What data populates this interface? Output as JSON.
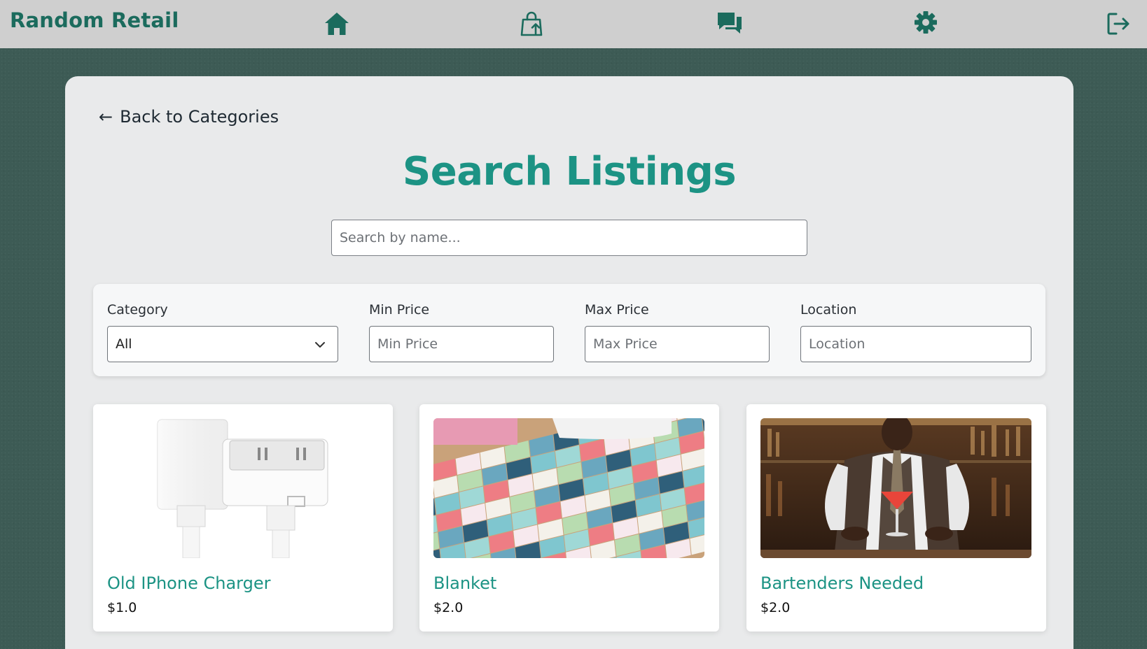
{
  "nav": {
    "brand": "Random Retail",
    "icons": [
      "home-icon",
      "shopping-bag-upload-icon",
      "chat-icon",
      "gear-icon",
      "logout-icon"
    ]
  },
  "colors": {
    "brand": "#1b6b5d",
    "accent": "#1c9384",
    "nav_bg": "#cfcfcf",
    "page_bg": "#3d5b55"
  },
  "main": {
    "back_label": "Back to Categories",
    "back_arrow": "←",
    "title": "Search Listings",
    "search_placeholder": "Search by name..."
  },
  "filters": {
    "category": {
      "label": "Category",
      "value": "All"
    },
    "min_price": {
      "label": "Min Price",
      "placeholder": "Min Price"
    },
    "max_price": {
      "label": "Max Price",
      "placeholder": "Max Price"
    },
    "location": {
      "label": "Location",
      "placeholder": "Location"
    }
  },
  "listings": [
    {
      "title": "Old IPhone Charger",
      "price": "$1.0",
      "image": "white-usb-charger-photo"
    },
    {
      "title": "Blanket",
      "price": "$2.0",
      "image": "patchwork-quilt-photo"
    },
    {
      "title": "Bartenders Needed",
      "price": "$2.0",
      "image": "bartender-cocktail-photo"
    }
  ]
}
